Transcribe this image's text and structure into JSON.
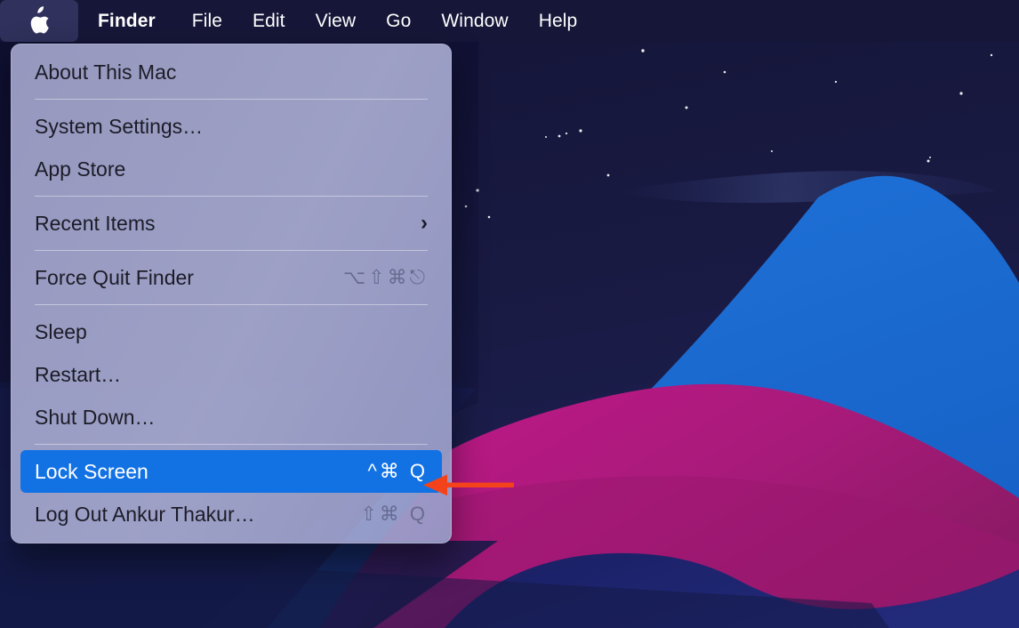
{
  "menubar": {
    "apple_icon": "apple-logo-icon",
    "items": [
      {
        "label": "Finder",
        "bold": true
      },
      {
        "label": "File",
        "bold": false
      },
      {
        "label": "Edit",
        "bold": false
      },
      {
        "label": "View",
        "bold": false
      },
      {
        "label": "Go",
        "bold": false
      },
      {
        "label": "Window",
        "bold": false
      },
      {
        "label": "Help",
        "bold": false
      }
    ]
  },
  "apple_menu": {
    "groups": [
      {
        "rows": [
          {
            "label": "About This Mac",
            "shortcut": "",
            "chevron": "",
            "selected": false
          }
        ]
      },
      {
        "rows": [
          {
            "label": "System Settings…",
            "shortcut": "",
            "chevron": "",
            "selected": false
          },
          {
            "label": "App Store",
            "shortcut": "",
            "chevron": "",
            "selected": false
          }
        ]
      },
      {
        "rows": [
          {
            "label": "Recent Items",
            "shortcut": "",
            "chevron": "›",
            "selected": false
          }
        ]
      },
      {
        "rows": [
          {
            "label": "Force Quit Finder",
            "shortcut": "⌥⇧⌘⎋",
            "chevron": "",
            "selected": false
          }
        ]
      },
      {
        "rows": [
          {
            "label": "Sleep",
            "shortcut": "",
            "chevron": "",
            "selected": false
          },
          {
            "label": "Restart…",
            "shortcut": "",
            "chevron": "",
            "selected": false
          },
          {
            "label": "Shut Down…",
            "shortcut": "",
            "chevron": "",
            "selected": false
          }
        ]
      },
      {
        "rows": [
          {
            "label": "Lock Screen",
            "shortcut": "^⌘ Q",
            "chevron": "",
            "selected": true
          },
          {
            "label": "Log Out Ankur Thakur…",
            "shortcut": "⇧⌘ Q",
            "chevron": "",
            "selected": false
          }
        ]
      }
    ]
  },
  "annotation": {
    "type": "arrow-pointing-left",
    "color": "#F4421B"
  },
  "colors": {
    "menubar_background": "#161638",
    "menu_background": "#A0A2C8",
    "highlight_blue": "#1272E4",
    "wallpaper_sky": "#151538",
    "wallpaper_blue": "#1C6FD4",
    "wallpaper_magenta": "#C01C86",
    "wallpaper_deep_navy": "#1B1F63"
  }
}
